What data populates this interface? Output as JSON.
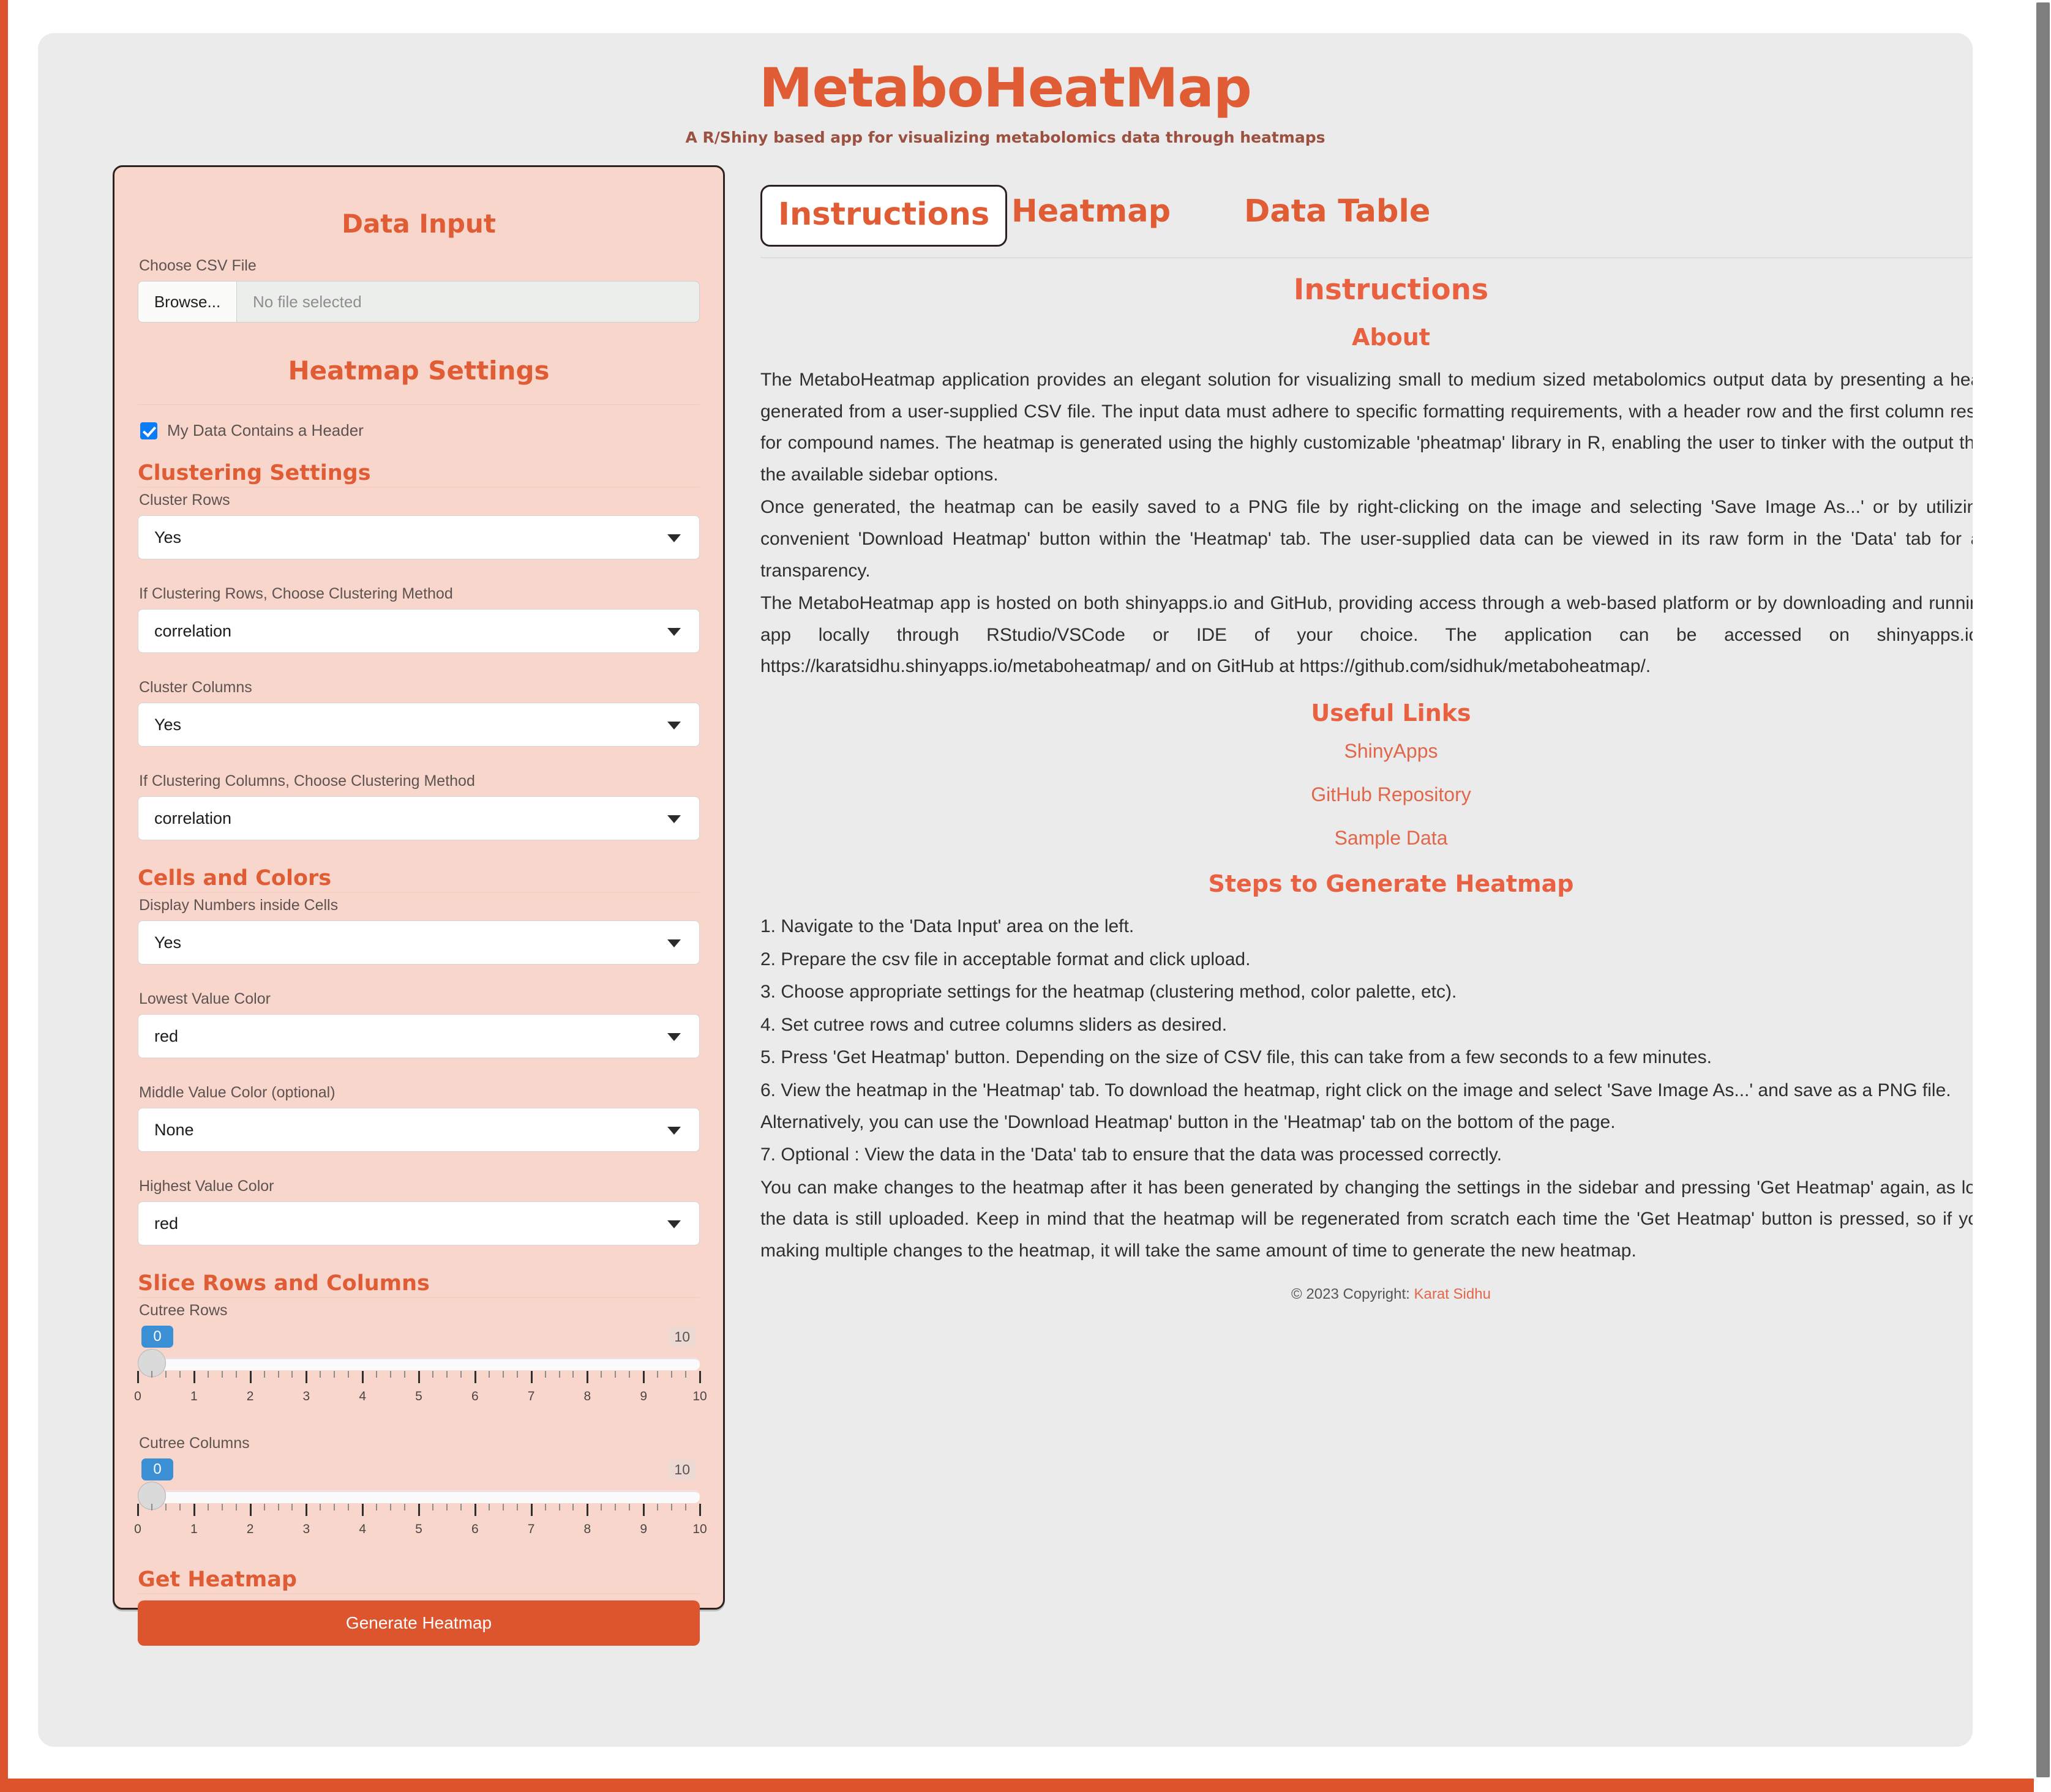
{
  "header": {
    "title": "MetaboHeatMap",
    "subtitle": "A R/Shiny based app for visualizing metabolomics data through heatmaps"
  },
  "colors": {
    "accent": "#e05c34",
    "accent_button": "#dd552d",
    "sidebar_bg": "#f8d6cc",
    "card_bg": "#ebebeb",
    "link": "#e2674a",
    "slider_bubble": "#3b8fd4",
    "checkbox": "#0a7cf5"
  },
  "sidebar": {
    "data_input_heading": "Data Input",
    "file_label": "Choose CSV File",
    "browse_button": "Browse...",
    "file_placeholder": "No file selected",
    "heatmap_settings_heading": "Heatmap Settings",
    "header_checkbox_label": "My Data Contains a Header",
    "header_checkbox_checked": true,
    "clustering_heading": "Clustering Settings",
    "fields": [
      {
        "label": "Cluster Rows",
        "value": "Yes"
      },
      {
        "label": "If Clustering Rows, Choose Clustering Method",
        "value": "correlation"
      },
      {
        "label": "Cluster Columns",
        "value": "Yes"
      },
      {
        "label": "If Clustering Columns, Choose Clustering Method",
        "value": "correlation"
      }
    ],
    "cells_colors_heading": "Cells and Colors",
    "color_fields": [
      {
        "label": "Display Numbers inside Cells",
        "value": "Yes"
      },
      {
        "label": "Lowest Value Color",
        "value": "red"
      },
      {
        "label": "Middle Value Color (optional)",
        "value": "None"
      },
      {
        "label": "Highest Value Color",
        "value": "red"
      }
    ],
    "slice_heading": "Slice Rows and Columns",
    "sliders": [
      {
        "label": "Cutree Rows",
        "value": "0",
        "max_label": "10",
        "min": 0,
        "max": 10,
        "ticks": [
          "0",
          "1",
          "2",
          "3",
          "4",
          "5",
          "6",
          "7",
          "8",
          "9",
          "10"
        ]
      },
      {
        "label": "Cutree Columns",
        "value": "0",
        "max_label": "10",
        "min": 0,
        "max": 10,
        "ticks": [
          "0",
          "1",
          "2",
          "3",
          "4",
          "5",
          "6",
          "7",
          "8",
          "9",
          "10"
        ]
      }
    ],
    "get_heatmap_heading": "Get Heatmap",
    "generate_button": "Generate Heatmap"
  },
  "main": {
    "tabs": [
      {
        "label": "Instructions",
        "active": true
      },
      {
        "label": "Heatmap",
        "active": false
      },
      {
        "label": "Data Table",
        "active": false
      }
    ],
    "page_heading": "Instructions",
    "about_heading": "About",
    "about_paragraphs": [
      "The MetaboHeatmap application provides an elegant solution for visualizing small to medium sized metabolomics output data by presenting a heatmap generated from a user-supplied CSV file. The input data must adhere to specific formatting requirements, with a header row and the first column reserved for compound names. The heatmap is generated using the highly customizable 'pheatmap' library in R, enabling the user to tinker with the output through the available sidebar options.",
      "Once generated, the heatmap can be easily saved to a PNG file by right-clicking on the image and selecting 'Save Image As...' or by utilizing the convenient 'Download Heatmap' button within the 'Heatmap' tab. The user-supplied data can be viewed in its raw form in the 'Data' tab for added transparency.",
      "The MetaboHeatmap app is hosted on both shinyapps.io and GitHub, providing access through a web-based platform or by downloading and running the app locally through RStudio/VSCode or IDE of your choice. The application can be accessed on shinyapps.io at https://karatsidhu.shinyapps.io/metaboheatmap/ and on GitHub at https://github.com/sidhuk/metaboheatmap/."
    ],
    "useful_links_heading": "Useful Links",
    "links": [
      {
        "label": "ShinyApps"
      },
      {
        "label": "GitHub Repository"
      },
      {
        "label": "Sample Data"
      }
    ],
    "steps_heading": "Steps to Generate Heatmap",
    "steps": [
      "1. Navigate to the 'Data Input' area on the left.",
      "2. Prepare the csv file in acceptable format and click upload.",
      "3. Choose appropriate settings for the heatmap (clustering method, color palette, etc).",
      "4. Set cutree rows and cutree columns sliders as desired.",
      "5. Press 'Get Heatmap' button. Depending on the size of CSV file, this can take from a few seconds to a few minutes.",
      "6. View the heatmap in the 'Heatmap' tab. To download the heatmap, right click on the image and select 'Save Image As...' and save as a PNG file. Alternatively, you can use the 'Download Heatmap' button in the 'Heatmap' tab on the bottom of the page.",
      "7. Optional : View the data in the 'Data' tab to ensure that the data was processed correctly."
    ],
    "closing_paragraph": "You can make changes to the heatmap after it has been generated by changing the settings in the sidebar and pressing 'Get Heatmap' again, as long as the data is still uploaded. Keep in mind that the heatmap will be regenerated from scratch each time the 'Get Heatmap' button is pressed, so if you are making multiple changes to the heatmap, it will take the same amount of time to generate the new heatmap.",
    "footer_prefix": "© 2023 Copyright:",
    "footer_author": "Karat Sidhu"
  }
}
